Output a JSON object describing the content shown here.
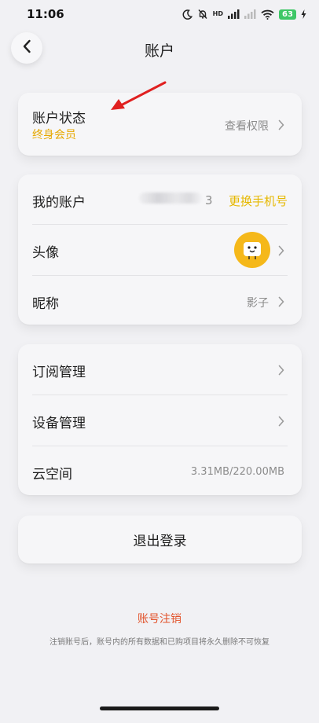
{
  "status_bar": {
    "time": "11:06",
    "network_label": "HD",
    "battery_level": "63",
    "icons": [
      "moon-icon",
      "bell-muted-icon",
      "signal-icon",
      "signal-weak-icon",
      "wifi-icon",
      "battery-icon",
      "charging-icon"
    ]
  },
  "header": {
    "title": "账户",
    "back_icon": "chevron-left-icon"
  },
  "membership": {
    "label": "账户状态",
    "status": "终身会员",
    "link": "查看权限",
    "status_color": "#e6a800"
  },
  "account": {
    "my_account_label": "我的账户",
    "phone_last_digit": "3",
    "change_phone_label": "更换手机号",
    "avatar_label": "头像",
    "nickname_label": "昵称",
    "nickname_value": "影子",
    "accent_color": "#e6b800"
  },
  "management": {
    "subscription_label": "订阅管理",
    "device_label": "设备管理",
    "cloud_label": "云空间",
    "cloud_usage": "3.31MB/220.00MB"
  },
  "logout": {
    "label": "退出登录"
  },
  "delete_account": {
    "title": "账号注销",
    "note": "注销账号后，账号内的所有数据和已购项目将永久删除不可恢复",
    "color": "#e2532b"
  }
}
